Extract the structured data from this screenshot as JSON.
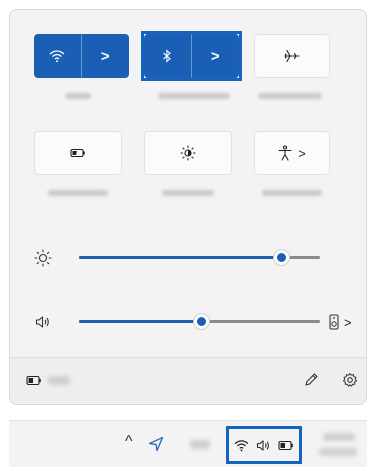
{
  "colors": {
    "accent": "#1a5fb4",
    "highlight": "#1565c0",
    "panel_bg": "#f3f3f3",
    "tile_off": "#fbfbfb"
  },
  "quick_settings": {
    "tiles_row1": [
      {
        "name": "wifi",
        "icon": "wifi-icon",
        "state": "on",
        "has_chevron": true,
        "label": ""
      },
      {
        "name": "bluetooth",
        "icon": "bluetooth-icon",
        "state": "on",
        "has_chevron": true,
        "highlighted": true,
        "label": ""
      },
      {
        "name": "airplane-mode",
        "icon": "airplane-icon",
        "state": "off",
        "label": ""
      }
    ],
    "tiles_row2": [
      {
        "name": "battery-saver",
        "icon": "battery-saver-icon",
        "state": "off",
        "label": ""
      },
      {
        "name": "night-light",
        "icon": "night-light-icon",
        "state": "off",
        "label": ""
      },
      {
        "name": "accessibility",
        "icon": "accessibility-icon",
        "state": "off",
        "has_chevron": true,
        "label": ""
      }
    ],
    "chevron": ">",
    "brightness": {
      "icon": "brightness-icon",
      "level": 0.84
    },
    "volume": {
      "icon": "speaker-icon",
      "level": 0.51,
      "output_icon": "speaker-device-icon",
      "chevron": ">"
    }
  },
  "footer": {
    "battery_icon": "battery-icon",
    "edit_icon": "pencil-icon",
    "settings_icon": "gear-icon"
  },
  "taskbar": {
    "overflow_icon": "chevron-up-icon",
    "location_icon": "location-icon",
    "tray_icons": [
      "wifi-icon",
      "speaker-icon",
      "battery-icon"
    ],
    "overflow_glyph": "^"
  }
}
